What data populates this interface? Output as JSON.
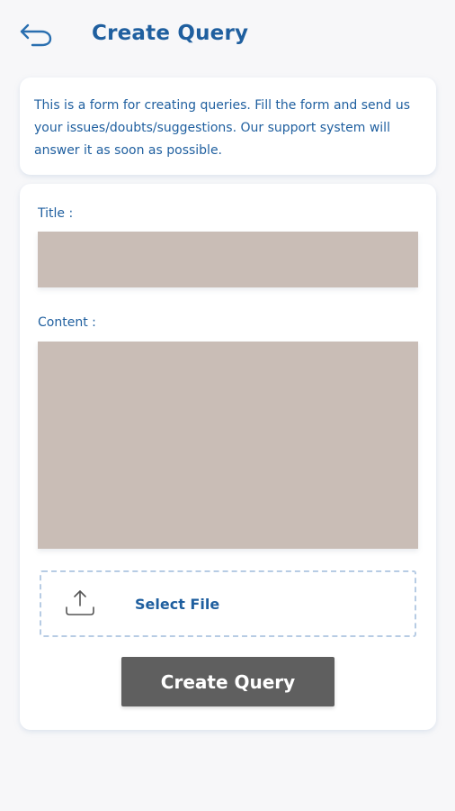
{
  "header": {
    "back_icon": "back-arrow-icon",
    "title": "Create Query"
  },
  "info": {
    "text": "This is a form for creating queries. Fill the form and send us your issues/doubts/suggestions. Our support system will answer it as soon as possible."
  },
  "form": {
    "title_label": "Title :",
    "title_value": "",
    "content_label": "Content :",
    "content_value": "",
    "file": {
      "icon": "upload-icon",
      "label": "Select File"
    },
    "submit_label": "Create Query"
  },
  "colors": {
    "accent": "#1f5f9f",
    "field_background": "#c9bdb6",
    "button_background": "#5f5f5f",
    "page_background": "#f7f7f9",
    "dashed_border": "#b7cce4"
  }
}
